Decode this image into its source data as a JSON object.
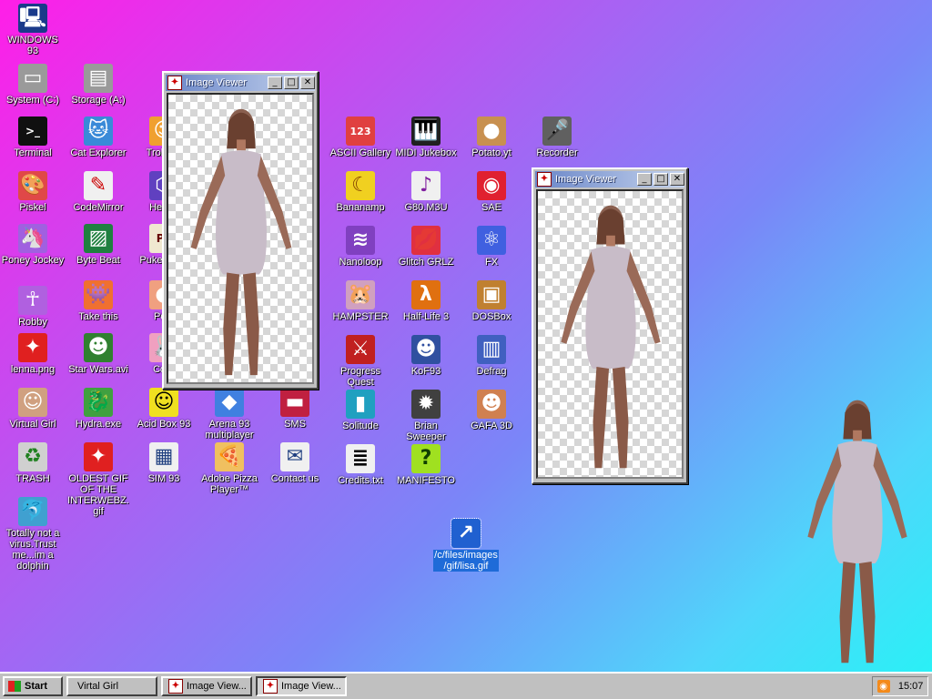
{
  "desktop": {
    "icons": [
      {
        "label": "WINDOWS 93",
        "glyph": "🖳",
        "bg": "#1a3a8a"
      },
      {
        "label": "System (C:)",
        "glyph": "▭",
        "bg": "#9a9a9a"
      },
      {
        "label": "Storage (A:)",
        "glyph": "▤",
        "bg": "#9a9a9a"
      },
      {
        "label": "Terminal",
        "glyph": ">_",
        "bg": "#101010"
      },
      {
        "label": "Cat Explorer",
        "glyph": "🐱",
        "bg": "#3a8ad8"
      },
      {
        "label": "Trollbox",
        "glyph": "☺",
        "bg": "#f0a030"
      },
      {
        "label": "Piskel",
        "glyph": "🎨",
        "bg": "#e04848"
      },
      {
        "label": "CodeMirror",
        "glyph": "✎",
        "bg": "#f0f0f0"
      },
      {
        "label": "Hexed",
        "glyph": "⬡",
        "bg": "#6040c0"
      },
      {
        "label": "Poney Jockey",
        "glyph": "🦄",
        "bg": "#a060e0"
      },
      {
        "label": "Byte Beat",
        "glyph": "▨",
        "bg": "#208040"
      },
      {
        "label": "Puke Paint",
        "glyph": "Pa",
        "bg": "#f0e8d0"
      },
      {
        "label": "Robby",
        "glyph": "☥",
        "bg": "#b060e0"
      },
      {
        "label": "Take this",
        "glyph": "👾",
        "bg": "#f07030"
      },
      {
        "label": "Polo",
        "glyph": "●",
        "bg": "#f0a080"
      },
      {
        "label": "lenna.png",
        "glyph": "✦",
        "bg": "#e02020"
      },
      {
        "label": "Star Wars.avi",
        "glyph": "☻",
        "bg": "#308030"
      },
      {
        "label": "Corn",
        "glyph": "🐰",
        "bg": "#f0a0c0"
      },
      {
        "label": "Virtual Girl",
        "glyph": "☺",
        "bg": "#d0a080"
      },
      {
        "label": "Hydra.exe",
        "glyph": "🐉",
        "bg": "#40a040"
      },
      {
        "label": "Acid Box 93",
        "glyph": "☺",
        "bg": "#f0e020"
      },
      {
        "label": "Arena 93 multiplayer",
        "glyph": "◆",
        "bg": "#4080e0"
      },
      {
        "label": "SMS",
        "glyph": "▬",
        "bg": "#c02040"
      },
      {
        "label": "TRASH",
        "glyph": "♻",
        "bg": "#d0d0d0"
      },
      {
        "label": "OLDEST GIF OF THE INTERWEBZ.gif",
        "glyph": "✦",
        "bg": "#e02020"
      },
      {
        "label": "SIM 93",
        "glyph": "▦",
        "bg": "#f0f0f0"
      },
      {
        "label": "Adobe Pizza Player™",
        "glyph": "🍕",
        "bg": "#f0c060"
      },
      {
        "label": "Contact us",
        "glyph": "✉",
        "bg": "#f0f0f0"
      },
      {
        "label": "Totally not a virus.Trust me...im a dolphin",
        "glyph": "🐬",
        "bg": "#40a0d0"
      },
      {
        "label": "ASCII Gallery",
        "glyph": "123",
        "bg": "#e04040"
      },
      {
        "label": "MIDI Jukebox",
        "glyph": "🎹",
        "bg": "#202020"
      },
      {
        "label": "Potato.yt",
        "glyph": "●",
        "bg": "#c89050"
      },
      {
        "label": "Recorder",
        "glyph": "🎤",
        "bg": "#606060"
      },
      {
        "label": "Bananamp",
        "glyph": "☾",
        "bg": "#f0d020"
      },
      {
        "label": "G80.M3U",
        "glyph": "♪",
        "bg": "#f0f0f0"
      },
      {
        "label": "SAE",
        "glyph": "◉",
        "bg": "#e02030"
      },
      {
        "label": "Nanoloop",
        "glyph": "≋",
        "bg": "#8040c0"
      },
      {
        "label": "Glitch GRLZ",
        "glyph": "💋",
        "bg": "#e03040"
      },
      {
        "label": "FX",
        "glyph": "⚛",
        "bg": "#4060e0"
      },
      {
        "label": "HAMPSTER",
        "glyph": "🐹",
        "bg": "#d0a0c0"
      },
      {
        "label": "Half-Life 3",
        "glyph": "λ",
        "bg": "#e07010"
      },
      {
        "label": "DOSBox",
        "glyph": "▣",
        "bg": "#c08030"
      },
      {
        "label": "Progress Quest",
        "glyph": "⚔",
        "bg": "#c02020"
      },
      {
        "label": "KoF93",
        "glyph": "☻",
        "bg": "#3050a0"
      },
      {
        "label": "Defrag",
        "glyph": "▥",
        "bg": "#4060c0"
      },
      {
        "label": "Solitude",
        "glyph": "▮",
        "bg": "#20a0c0"
      },
      {
        "label": "Brian Sweeper",
        "glyph": "✹",
        "bg": "#404040"
      },
      {
        "label": "GAFA 3D",
        "glyph": "☻",
        "bg": "#d08050"
      },
      {
        "label": "Credits.txt",
        "glyph": "≣",
        "bg": "#f0f0f0"
      },
      {
        "label": "MANIFESTO",
        "glyph": "?",
        "bg": "#a0e020"
      },
      {
        "label": "/c/files/images/gif/lisa.gif",
        "glyph": "↗",
        "bg": "#2060d0"
      }
    ]
  },
  "windows": [
    {
      "title": "Image Viewer",
      "minimize": "_",
      "maximize": "□",
      "close": "✕"
    },
    {
      "title": "Image Viewer",
      "minimize": "_",
      "maximize": "□",
      "close": "✕"
    }
  ],
  "taskbar": {
    "start_label": "Start",
    "items": [
      {
        "label": "Virtal Girl"
      },
      {
        "label": "Image View..."
      },
      {
        "label": "Image View..."
      }
    ],
    "clock": "15:07"
  }
}
